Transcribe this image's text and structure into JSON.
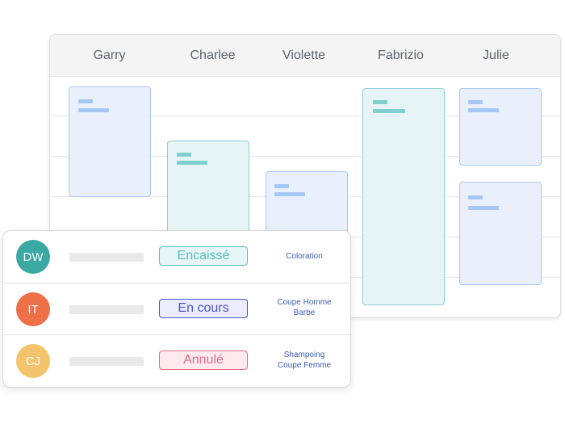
{
  "calendar": {
    "staff": [
      "Garry",
      "Charlee",
      "Violette",
      "Fabrizio",
      "Julie"
    ]
  },
  "appointments": [
    {
      "initials": "DW",
      "avatar_color": "#3aa8a3",
      "status": "Encaissé",
      "status_color": "#5bbec3",
      "status_bg": "#e6f5f5",
      "services": [
        "Coloration"
      ]
    },
    {
      "initials": "IT",
      "avatar_color": "#ee7049",
      "status": "En cours",
      "status_color": "#4b56c9",
      "status_bg": "#ebedfc",
      "services": [
        "Coupe Homme",
        "Barbe"
      ]
    },
    {
      "initials": "CJ",
      "avatar_color": "#f3c46b",
      "status": "Annulé",
      "status_color": "#e56a8a",
      "status_bg": "#fdeaef",
      "services": [
        "Shampoing",
        "Coupe Femme"
      ]
    }
  ]
}
